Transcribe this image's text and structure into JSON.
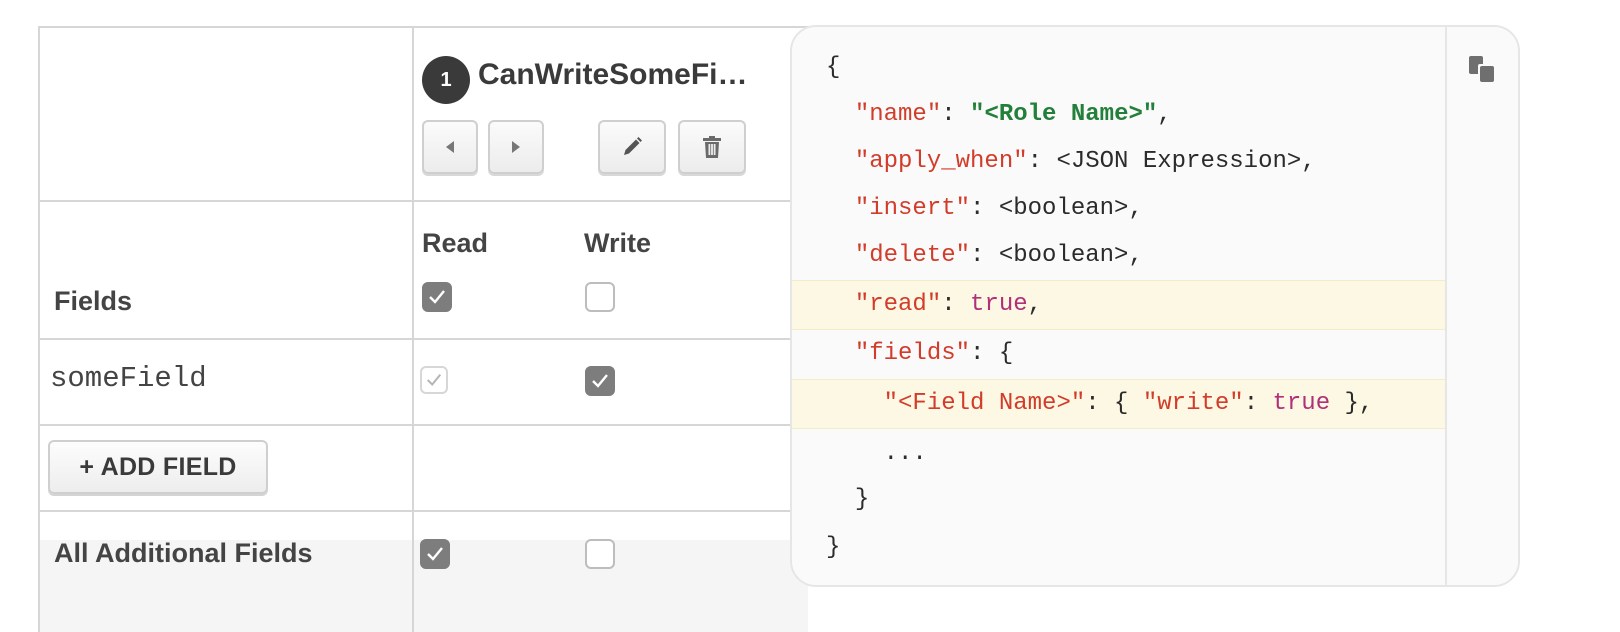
{
  "rules": {
    "role": {
      "number": "1",
      "name": "CanWriteSomeFi…"
    },
    "columns": {
      "read": "Read",
      "write": "Write"
    },
    "fields_header": "Fields",
    "field_rows": [
      {
        "name": "someField",
        "read": true,
        "write": true
      }
    ],
    "fields_header_checks": {
      "read": true,
      "write": false
    },
    "add_field_label": "+ ADD FIELD",
    "additional": {
      "label": "All Additional Fields",
      "read": true,
      "write": false
    }
  },
  "code": {
    "open_brace": "{",
    "name_key": "\"name\"",
    "name_value": "\"<Role Name>\"",
    "apply_key": "\"apply_when\"",
    "apply_value": ": <JSON Expression>,",
    "insert_key": "\"insert\"",
    "insert_value": ": <boolean>,",
    "delete_key": "\"delete\"",
    "delete_value": ": <boolean>,",
    "read_key": "\"read\"",
    "read_value": "true",
    "fields_key": "\"fields\"",
    "fields_open": ": {",
    "field_name_key": "\"<Field Name>\"",
    "write_key": "\"write\"",
    "write_value": "true",
    "ellipsis": "...",
    "inner_close": "}",
    "close_brace": "}"
  },
  "colors": {
    "key": "#d23c2a",
    "string": "#237f3a",
    "boolean": "#b0307a",
    "highlight": "#fdf8e3"
  },
  "icons": [
    "chevron-left-icon",
    "chevron-right-icon",
    "pencil-icon",
    "trash-icon",
    "checkmark-icon",
    "copy-icon"
  ]
}
